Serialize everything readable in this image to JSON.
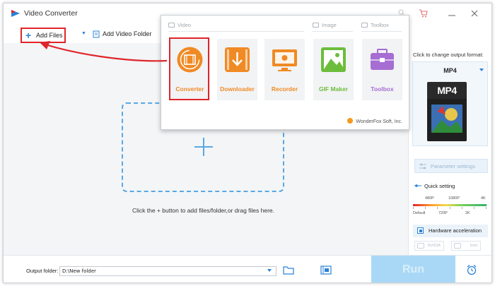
{
  "window": {
    "title": "Video Converter"
  },
  "toolbar": {
    "add_files_label": "Add Files",
    "add_video_folder_label": "Add Video Folder"
  },
  "main": {
    "hint": "Click the + button to add files/folder,or drag files here."
  },
  "popup": {
    "sections": {
      "video": "Video",
      "image": "Image",
      "toolbox": "Toolbox"
    },
    "tools": [
      {
        "label": "Converter",
        "color": "#f08a24"
      },
      {
        "label": "Downloader",
        "color": "#f08a24"
      },
      {
        "label": "Recorder",
        "color": "#f08a24"
      },
      {
        "label": "GIF Maker",
        "color": "#6cbd3c"
      },
      {
        "label": "Toolbox",
        "color": "#a66dd2"
      }
    ],
    "brand": "WonderFox Soft, Inc."
  },
  "right_panel": {
    "caption": "Click to change output format:",
    "format": "MP4",
    "format_icon_text": "MP4",
    "parameter_settings": "Parameter settings",
    "quick_setting": "Quick setting",
    "slider_top": [
      "480P",
      "1080P",
      "4K"
    ],
    "slider_bottom": [
      "Default",
      "720P",
      "2K"
    ],
    "hardware_acceleration": "Hardware acceleration",
    "gpu_nvidia": "NVIDIA",
    "gpu_intel": "Intel"
  },
  "bottom": {
    "output_folder_label": "Output folder:",
    "output_folder_value": "D:\\New folder",
    "run_label": "Run"
  },
  "colors": {
    "accent": "#2a82d7",
    "highlight": "#e0252a",
    "run_bg": "#a9d8f6"
  }
}
